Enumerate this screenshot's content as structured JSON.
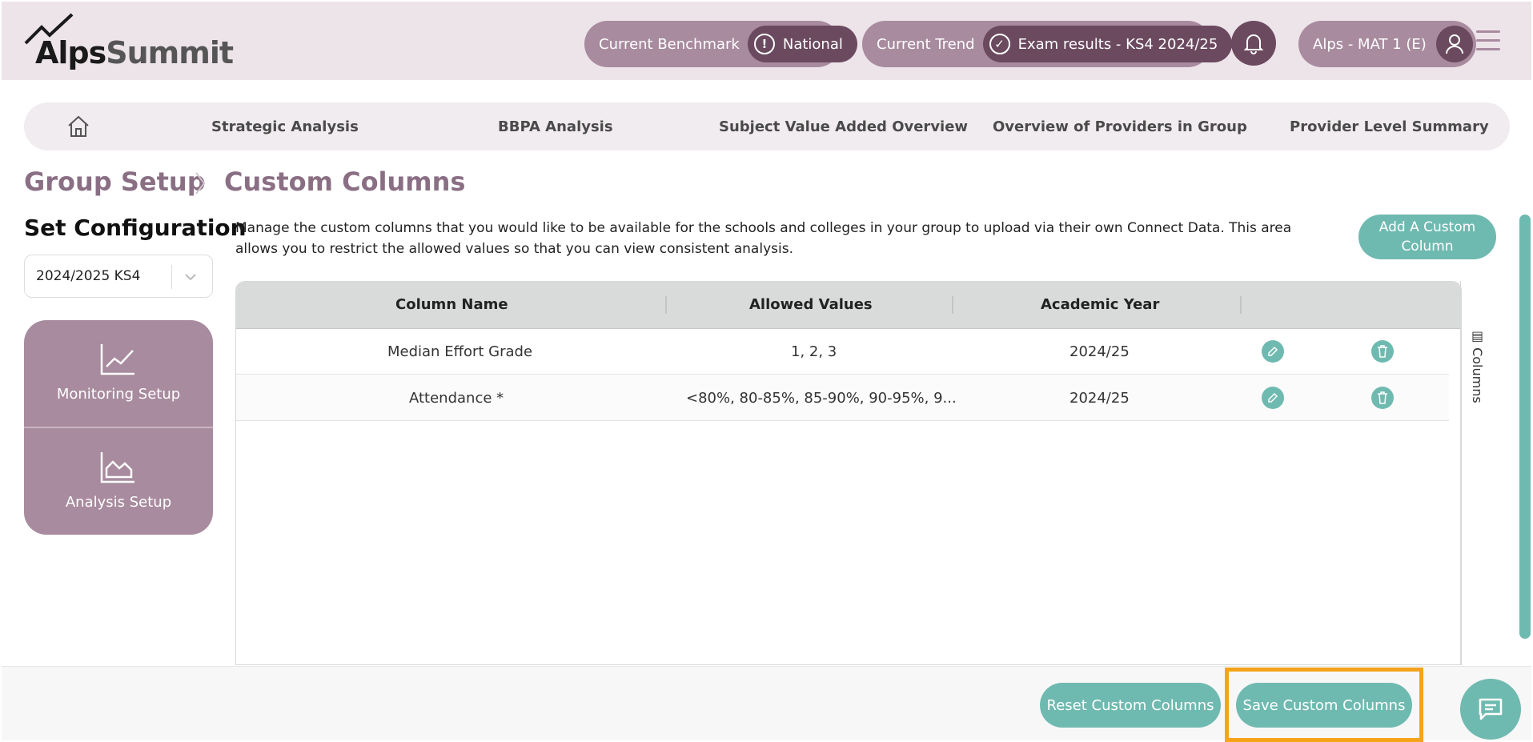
{
  "header": {
    "logo_main": "Alps",
    "logo_sub": "Summit",
    "benchmark_label": "Current Benchmark",
    "benchmark_value": "National",
    "trend_label": "Current Trend",
    "trend_value": "Exam results - KS4 2024/25",
    "user_label": "Alps - MAT 1 (E)"
  },
  "nav": {
    "items": [
      "Strategic Analysis",
      "BBPA Analysis",
      "Subject Value Added Overview",
      "Overview of Providers in Group",
      "Provider Level Summary"
    ]
  },
  "breadcrumb": {
    "parent": "Group Setup",
    "current": "Custom Columns"
  },
  "sidebar": {
    "title": "Set Configuration",
    "config_select": "2024/2025 KS4",
    "items": [
      {
        "label": "Monitoring Setup",
        "icon": "line-chart-icon"
      },
      {
        "label": "Analysis Setup",
        "icon": "area-chart-icon"
      }
    ]
  },
  "main": {
    "description": "Manage the custom columns that you would like to be available for the schools and colleges in your group to upload via their own Connect Data. This area allows you to restrict the allowed values so that you can view consistent analysis.",
    "add_button": "Add A Custom Column",
    "table": {
      "headers": [
        "Column Name",
        "Allowed Values",
        "Academic Year"
      ],
      "rows": [
        {
          "name": "Median Effort Grade",
          "values": "1, 2, 3",
          "year": "2024/25"
        },
        {
          "name": "Attendance *",
          "values": "<80%, 80-85%, 85-90%, 90-95%, 9...",
          "year": "2024/25"
        }
      ],
      "columns_toggle": "Columns"
    }
  },
  "footer": {
    "reset_button": "Reset Custom Columns",
    "save_button": "Save Custom Columns"
  },
  "colors": {
    "accent": "#6fbab0",
    "brand": "#a88b9e",
    "brand_dark": "#6b4a5f",
    "highlight": "#f5a31a"
  }
}
